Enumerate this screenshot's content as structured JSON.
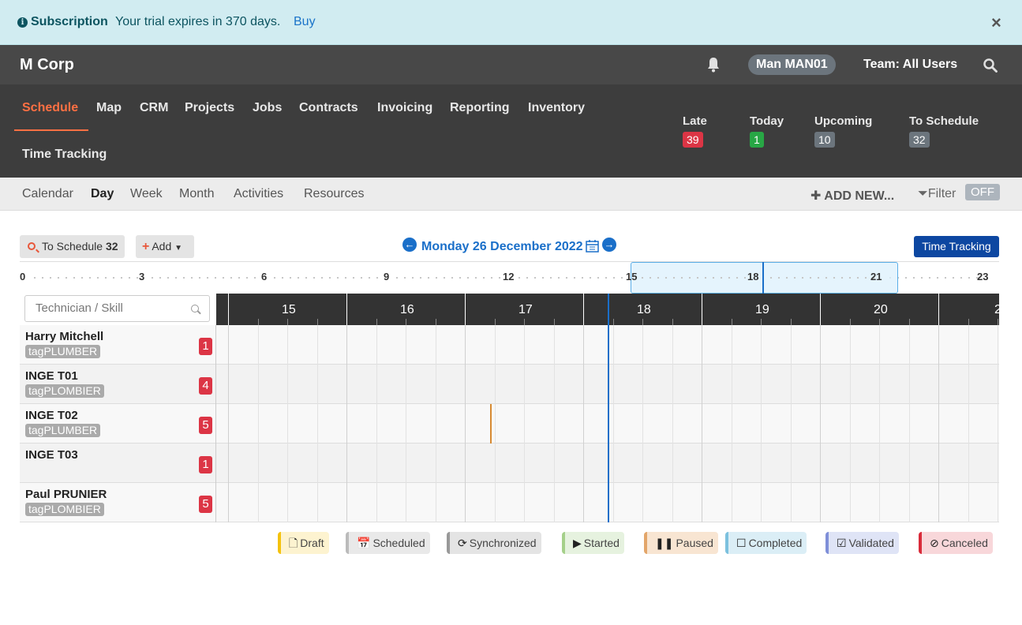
{
  "banner": {
    "title": "Subscription",
    "message": "Your trial expires in 370 days.",
    "link": "Buy",
    "close": "×"
  },
  "topbar": {
    "brand": "M Corp",
    "user": "Man MAN01",
    "team": "Team: All Users"
  },
  "nav": {
    "items": [
      "Schedule",
      "Map",
      "CRM",
      "Projects",
      "Jobs",
      "Contracts",
      "Invoicing",
      "Reporting",
      "Inventory",
      "Time Tracking"
    ],
    "active": "Schedule"
  },
  "stats": [
    {
      "label": "Late",
      "count": "39",
      "color": "#dc3545"
    },
    {
      "label": "Today",
      "count": "1",
      "color": "#28a745"
    },
    {
      "label": "Upcoming",
      "count": "10",
      "color": "#6c757d"
    },
    {
      "label": "To Schedule",
      "count": "32",
      "color": "#6c757d"
    }
  ],
  "subnav": {
    "items": [
      "Calendar",
      "Day",
      "Week",
      "Month",
      "Activities",
      "Resources"
    ],
    "active": "Day",
    "add_new": "ADD NEW...",
    "filter": "Filter",
    "filter_state": "OFF"
  },
  "toolbar": {
    "to_schedule_label": "To Schedule",
    "to_schedule_count": "32",
    "add_label": "Add",
    "date": "Monday 26 December 2022",
    "time_tracking": "Time Tracking"
  },
  "overview": {
    "ticks": [
      "0",
      "3",
      "6",
      "9",
      "12",
      "15",
      "18",
      "21",
      "23"
    ],
    "window_start_hour": 15,
    "window_end_hour": 21.5,
    "now_hour": 18
  },
  "grid": {
    "search_placeholder": "Technician / Skill",
    "hours": [
      "15",
      "16",
      "17",
      "18",
      "19",
      "20",
      "2"
    ]
  },
  "technicians": [
    {
      "name": "Harry Mitchell",
      "tag": "tagPLUMBER",
      "count": "1"
    },
    {
      "name": "INGE T01",
      "tag": "tagPLOMBIER",
      "count": "4"
    },
    {
      "name": "INGE T02",
      "tag": "tagPLUMBER",
      "count": "5"
    },
    {
      "name": "INGE T03",
      "tag": "",
      "count": "1"
    },
    {
      "name": "Paul PRUNIER",
      "tag": "tagPLOMBIER",
      "count": "5"
    }
  ],
  "legend": [
    {
      "label": "Draft",
      "icon": "file-icon",
      "glyph": "🗋",
      "bg": "#fdf3d0",
      "border": "#f4c20d"
    },
    {
      "label": "Scheduled",
      "icon": "calendar-icon",
      "glyph": "📅",
      "bg": "#e9e9e9",
      "border": "#bbbbbb"
    },
    {
      "label": "Synchronized",
      "icon": "sync-icon",
      "glyph": "⟳",
      "bg": "#e4e4e4",
      "border": "#999999"
    },
    {
      "label": "Started",
      "icon": "play-icon",
      "glyph": "▶",
      "bg": "#e6f2df",
      "border": "#a5d08a"
    },
    {
      "label": "Paused",
      "icon": "pause-icon",
      "glyph": "❚❚",
      "bg": "#f8e5d2",
      "border": "#e3a66a"
    },
    {
      "label": "Completed",
      "icon": "square-icon",
      "glyph": "☐",
      "bg": "#dbeef6",
      "border": "#7cc1de"
    },
    {
      "label": "Validated",
      "icon": "check-square-icon",
      "glyph": "☑",
      "bg": "#dfe4f6",
      "border": "#7f8fd8"
    },
    {
      "label": "Canceled",
      "icon": "ban-icon",
      "glyph": "⊘",
      "bg": "#f8d7da",
      "border": "#d92b3a"
    }
  ]
}
